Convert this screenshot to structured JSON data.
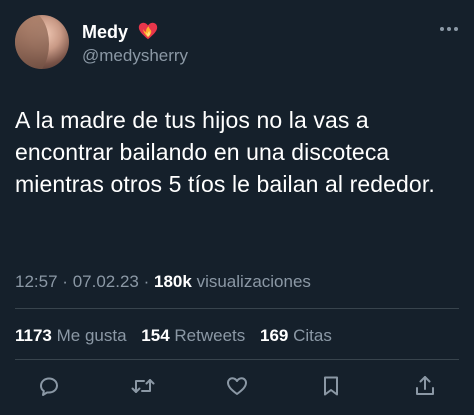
{
  "author": {
    "name": "Medy",
    "handle": "@medysherry",
    "badge_icon": "heart-on-fire-emoji"
  },
  "tweet": {
    "text": "A la madre de tus hijos no la vas a encontrar bailando en una discoteca mientras otros 5 tíos le bailan al rededor."
  },
  "meta": {
    "time": "12:57",
    "separator": "·",
    "date": "07.02.23",
    "views_count": "180k",
    "views_label": "visualizaciones"
  },
  "stats": {
    "likes_count": "1173",
    "likes_label": "Me gusta",
    "retweets_count": "154",
    "retweets_label": "Retweets",
    "quotes_count": "169",
    "quotes_label": "Citas"
  },
  "actions": [
    "reply-icon",
    "retweet-icon",
    "like-icon",
    "bookmark-icon",
    "share-icon"
  ],
  "colors": {
    "background": "#15202b",
    "secondary_text": "#8b98a5",
    "divider": "#38444d"
  }
}
